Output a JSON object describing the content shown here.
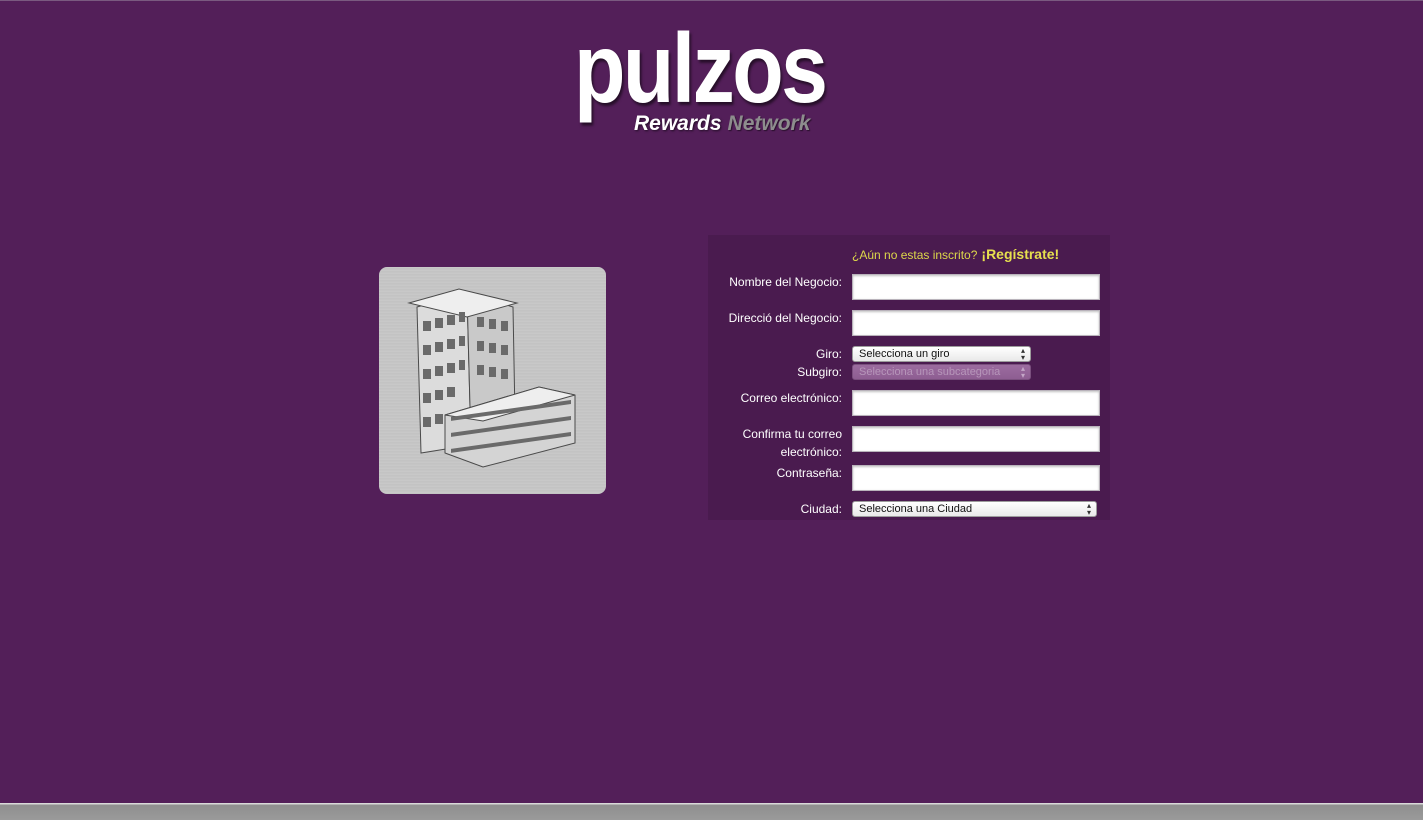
{
  "logo": {
    "word": "pulzos",
    "rewards": "Rewards",
    "network": "Network"
  },
  "image": {
    "icon": "office-building-icon"
  },
  "form": {
    "register_prompt": "¿Aún no estas inscrito?",
    "register_link": "¡Regístrate!",
    "fields": {
      "business_name_label": "Nombre del Negocio:",
      "business_name_value": "",
      "business_address_label": "Direcció del Negocio:",
      "business_address_value": "",
      "giro_label": "Giro:",
      "giro_value": "Selecciona un giro",
      "subgiro_label": "Subgiro:",
      "subgiro_value": "Selecciona una subcategoria",
      "email_label": "Correo electrónico:",
      "email_value": "",
      "email_confirm_label_1": "Confirma tu correo",
      "email_confirm_label_2": "electrónico:",
      "email_confirm_value": "",
      "password_label": "Contraseña:",
      "password_value": "",
      "city_label": "Ciudad:",
      "city_value": "Selecciona una Ciudad"
    }
  },
  "colors": {
    "background": "#531f59",
    "panel": "#4a1b4f",
    "accent_yellow": "#e6e04e",
    "label_text": "#ffffff"
  }
}
